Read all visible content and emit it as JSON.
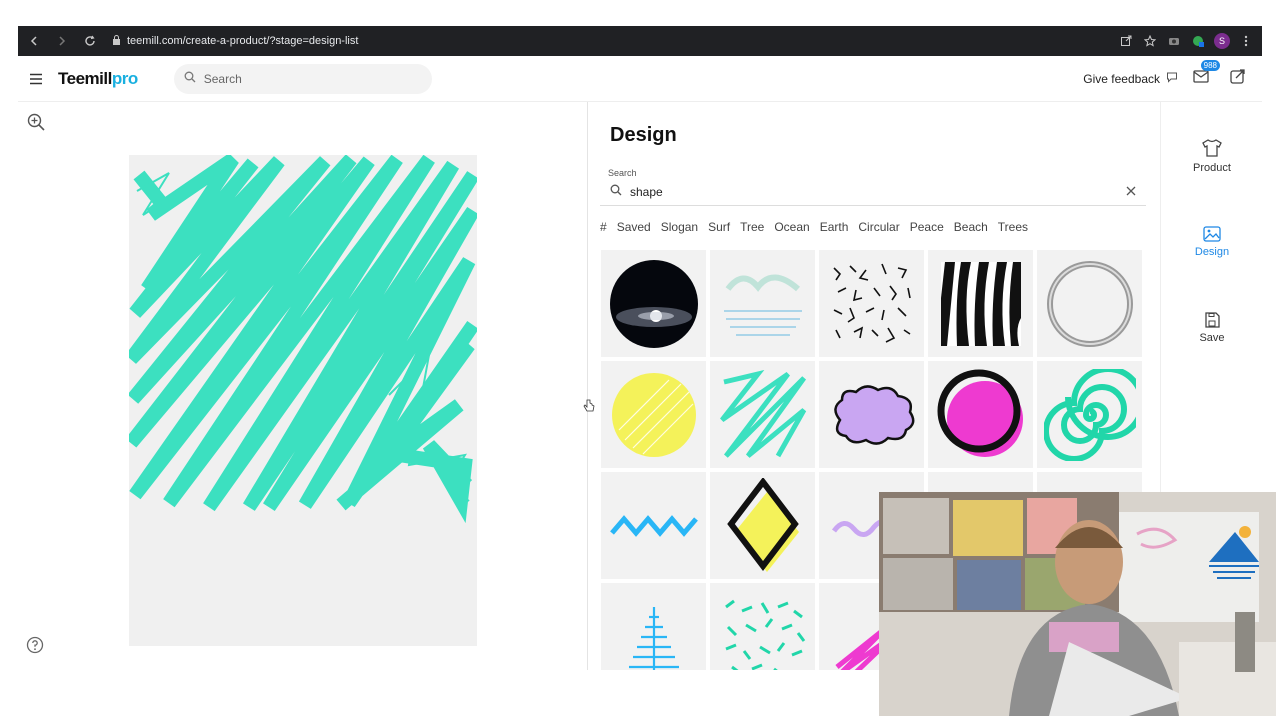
{
  "browser": {
    "url": "teemill.com/create-a-product/?stage=design-list",
    "profile_initial": "S"
  },
  "header": {
    "logo_main": "Teemill",
    "logo_pro": "pro",
    "search_placeholder": "Search",
    "feedback_label": "Give feedback",
    "notif_count": "988"
  },
  "design": {
    "title": "Design",
    "search_label": "Search",
    "search_value": "shape",
    "tags": [
      "#",
      "Saved",
      "Slogan",
      "Surf",
      "Tree",
      "Ocean",
      "Earth",
      "Circular",
      "Peace",
      "Beach",
      "Trees"
    ]
  },
  "sidebar": {
    "items": [
      {
        "label": "Product"
      },
      {
        "label": "Design"
      },
      {
        "label": "Save"
      }
    ]
  },
  "colors": {
    "accent": "#1e88e5",
    "mint": "#3ce0c0",
    "yellow": "#f4f25a",
    "pink": "#ee3ad0",
    "lilac": "#c9a6f2",
    "sky": "#29b6f6"
  }
}
